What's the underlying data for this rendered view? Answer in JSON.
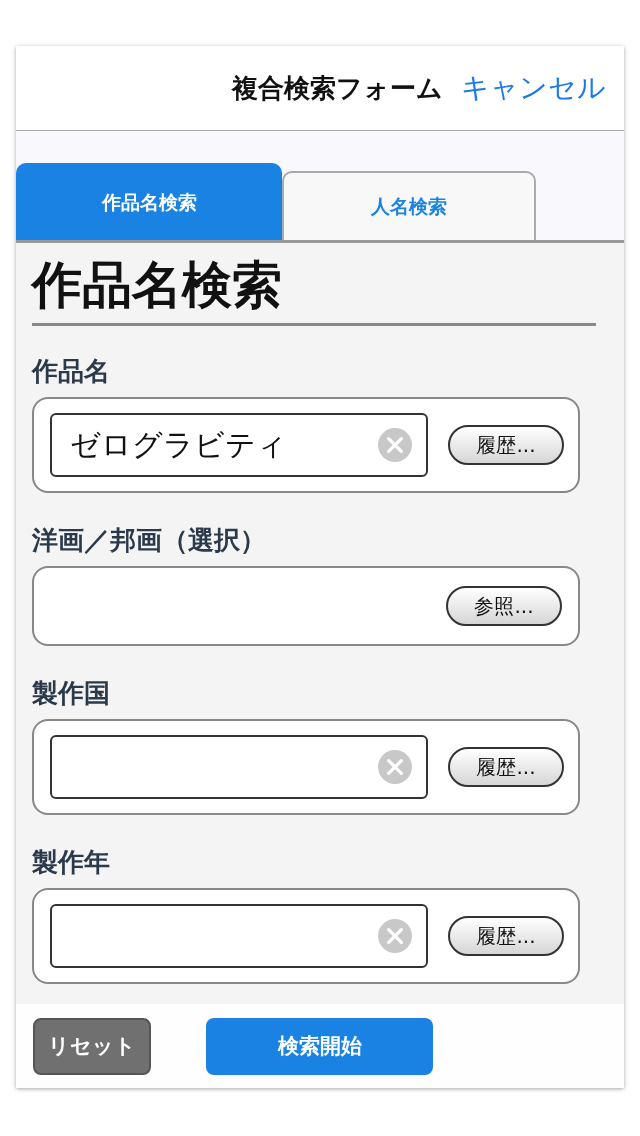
{
  "header": {
    "title": "複合検索フォーム",
    "cancel": "キャンセル"
  },
  "tabs": [
    {
      "label": "作品名検索",
      "selected": true
    },
    {
      "label": "人名検索",
      "selected": false
    }
  ],
  "heading": "作品名検索",
  "fields": [
    {
      "kind": "text",
      "label": "作品名",
      "value": "ゼログラビティ",
      "button": "履歴..."
    },
    {
      "kind": "select",
      "label": "洋画／邦画（選択）",
      "button": "参照..."
    },
    {
      "kind": "text",
      "label": "製作国",
      "button": "履歴..."
    },
    {
      "kind": "text",
      "label": "製作年",
      "button": "履歴..."
    }
  ],
  "footer": {
    "reset": "リセット",
    "search": "検索開始"
  }
}
